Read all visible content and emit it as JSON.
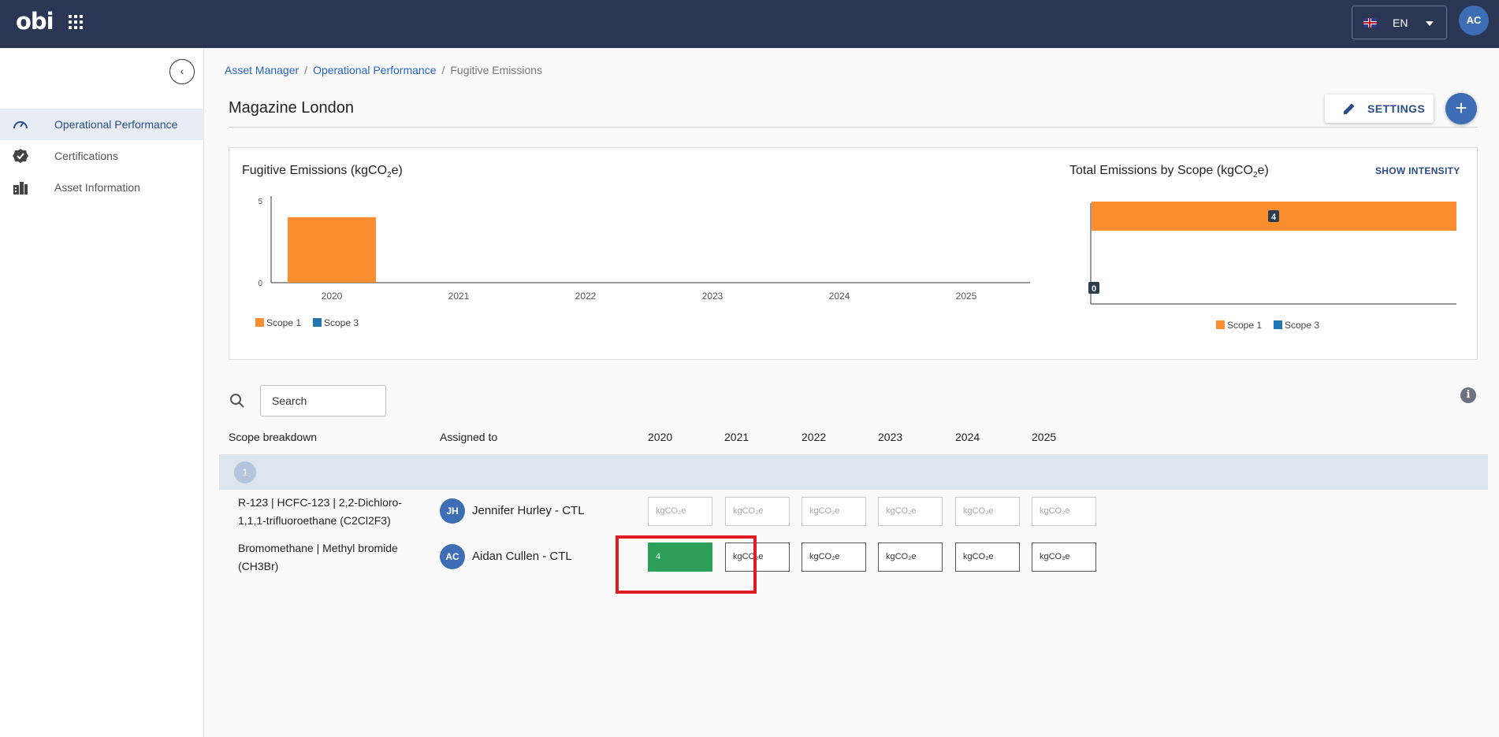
{
  "topbar": {
    "logo": "obi",
    "language": "EN",
    "user_initials": "AC"
  },
  "sidebar": {
    "items": [
      {
        "label": "Operational Performance",
        "icon": "speedometer-icon",
        "active": true
      },
      {
        "label": "Certifications",
        "icon": "badge-check-icon",
        "active": false
      },
      {
        "label": "Asset Information",
        "icon": "buildings-icon",
        "active": false
      }
    ]
  },
  "breadcrumb": [
    "Asset Manager",
    "Operational Performance",
    "Fugitive Emissions"
  ],
  "page": {
    "title": "Magazine London",
    "settings_label": "SETTINGS",
    "add_label": "+"
  },
  "charts": {
    "fugitive_title_pre": "Fugitive Emissions (kgCO",
    "fugitive_title_sub": "2",
    "fugitive_title_post": "e)",
    "scope_title_pre": "Total Emissions by Scope (kgCO",
    "scope_title_sub": "2",
    "scope_title_post": "e)",
    "show_intensity": "SHOW INTENSITY"
  },
  "chart_data": [
    {
      "type": "bar",
      "title": "Fugitive Emissions (kgCO2e)",
      "categories": [
        "2020",
        "2021",
        "2022",
        "2023",
        "2024",
        "2025"
      ],
      "series": [
        {
          "name": "Scope 1",
          "values": [
            4,
            0,
            0,
            0,
            0,
            0
          ],
          "color": "#fd8d2e"
        },
        {
          "name": "Scope 3",
          "values": [
            0,
            0,
            0,
            0,
            0,
            0
          ],
          "color": "#1f77b4"
        }
      ],
      "y_ticks": [
        "0",
        "5"
      ],
      "ylim": [
        0,
        5
      ],
      "legend": "bottom-left"
    },
    {
      "type": "bar",
      "orientation": "horizontal",
      "title": "Total Emissions by Scope (kgCO2e)",
      "series": [
        {
          "name": "Scope 1",
          "value": 4,
          "label": "4",
          "color": "#fd8d2e"
        },
        {
          "name": "Scope 3",
          "value": 0,
          "label": "0",
          "color": "#1f77b4"
        }
      ],
      "legend": "bottom-center"
    }
  ],
  "table": {
    "search_placeholder": "Search",
    "info_icon": "i",
    "headers": {
      "scope": "Scope breakdown",
      "assigned": "Assigned to",
      "years": [
        "2020",
        "2021",
        "2022",
        "2023",
        "2024",
        "2025"
      ]
    },
    "group_badge": "1",
    "rows": [
      {
        "label": "R-123 | HCFC-123 | 2,2-Dichloro-1,1,1-trifluoroethane (C2Cl2F3)",
        "initials": "JH",
        "assignee": "Jennifer Hurley - CTL",
        "cells": [
          "kgCO₂e",
          "kgCO₂e",
          "kgCO₂e",
          "kgCO₂e",
          "kgCO₂e",
          "kgCO₂e"
        ],
        "disabled": true
      },
      {
        "label": "Bromomethane | Methyl bromide (CH3Br)",
        "initials": "AC",
        "assignee": "Aidan Cullen - CTL",
        "cells": [
          "4",
          "kgCO₂e",
          "kgCO₂e",
          "kgCO₂e",
          "kgCO₂e",
          "kgCO₂e"
        ],
        "disabled": false
      }
    ]
  }
}
